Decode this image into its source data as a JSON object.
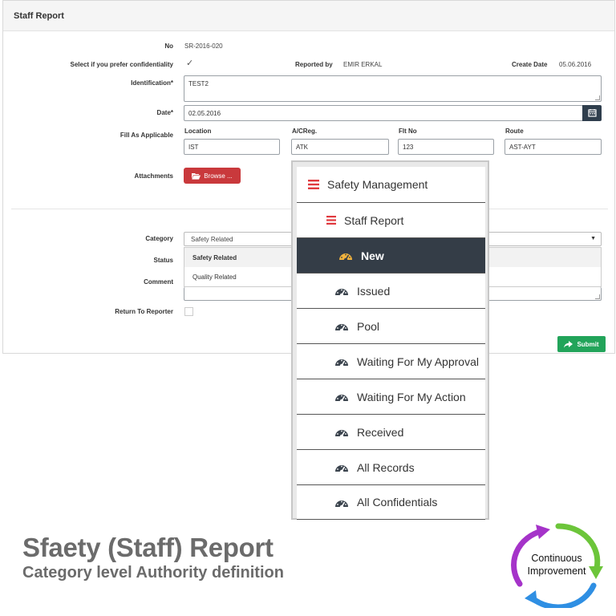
{
  "panel": {
    "title": "Staff Report"
  },
  "form": {
    "no_label": "No",
    "no_value": "SR-2016-020",
    "confidential_label": "Select if you prefer confidentiality",
    "confidential_checked": true,
    "reported_by_label": "Reported by",
    "reported_by_value": "EMIR ERKAL",
    "create_date_label": "Create Date",
    "create_date_value": "05.06.2016",
    "identification_label": "Identification*",
    "identification_value": "TEST2",
    "date_label": "Date*",
    "date_value": "02.05.2016",
    "fill_label": "Fill As Applicable",
    "location_label": "Location",
    "location_value": "IST",
    "acreg_label": "A/CReg.",
    "acreg_value": "ATK",
    "fltno_label": "Flt No",
    "fltno_value": "123",
    "route_label": "Route",
    "route_value": "AST-AYT",
    "attachments_label": "Attachments",
    "browse_label": "Browse ...",
    "category_label": "Category",
    "category_value": "Safety Related",
    "category_options": [
      "Safety Related",
      "Quality Related"
    ],
    "status_label": "Status",
    "comment_label": "Comment",
    "return_label": "Return To Reporter",
    "submit_label": "Submit"
  },
  "menu": {
    "root": "Safety Management",
    "section": "Staff Report",
    "items": [
      {
        "label": "New",
        "active": true
      },
      {
        "label": "Issued"
      },
      {
        "label": "Pool"
      },
      {
        "label": "Waiting For My Approval"
      },
      {
        "label": "Waiting For My Action"
      },
      {
        "label": "Received"
      },
      {
        "label": "All Records"
      },
      {
        "label": "All Confidentials"
      }
    ]
  },
  "caption": {
    "title": "Sfaety (Staff) Report",
    "subtitle": "Category level Authority definition"
  },
  "logo": {
    "line1": "Continuous",
    "line2": "Improvement"
  },
  "colors": {
    "menu_active_bg": "#343d47",
    "browse_button": "#c9393c",
    "submit_button": "#22a45a",
    "calendar_button": "#2f3e4d",
    "menu_icon_red": "#e0393e",
    "gauge_yellow": "#f2b33d"
  },
  "icons": {
    "calendar": "calendar-icon",
    "browse": "folder-open-icon",
    "submit": "share-arrow-icon",
    "menu": "hamburger-icon",
    "menu_item": "dashboard-gauge-icon"
  }
}
